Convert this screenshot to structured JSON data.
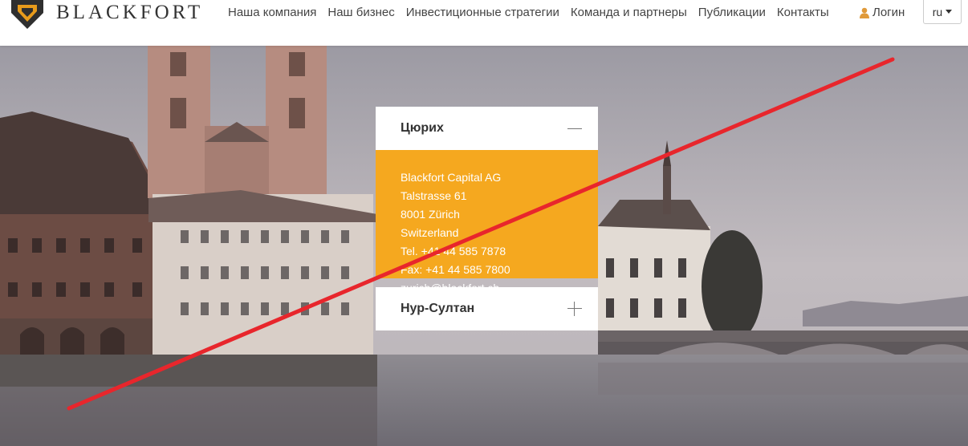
{
  "header": {
    "brand": "BLACKFORT",
    "nav": [
      "Наша компания",
      "Наш бизнес",
      "Инвестиционные стратегии",
      "Команда и партнеры",
      "Публикации",
      "Контакты"
    ],
    "login": "Логин",
    "language": "ru"
  },
  "offices": [
    {
      "city": "Цюрих",
      "expanded": true,
      "lines": [
        "Blackfort Capital AG",
        "Talstrasse 61",
        "8001 Zürich",
        "Switzerland",
        "Tel. +41 44 585 7878",
        "Fax: +41 44 585 7800",
        "zurich@blackfort.ch"
      ]
    },
    {
      "city": "Нур-Султан",
      "expanded": false
    }
  ],
  "colors": {
    "accent": "#f5a81f",
    "strike": "#e8262c"
  },
  "icons": [
    "blackfort-logo-icon",
    "user-icon",
    "chevron-down-icon",
    "minus-icon",
    "plus-icon"
  ]
}
